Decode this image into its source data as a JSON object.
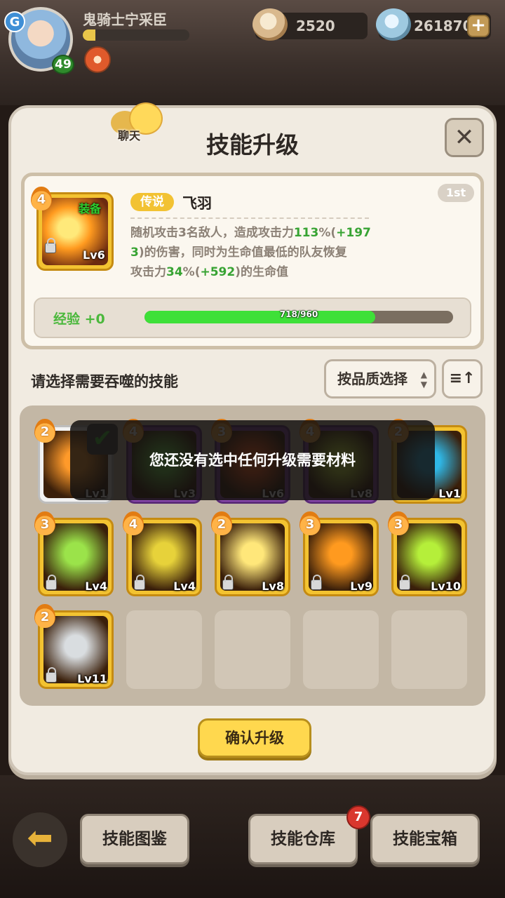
{
  "header": {
    "player_name": "鬼骑士宁采臣",
    "player_level": "49",
    "exp_fraction": 0.12,
    "avatar_badge": "G",
    "currency1": {
      "icon": "shell-icon",
      "value": "2520"
    },
    "currency2": {
      "icon": "gem-icon",
      "value": "261870",
      "add": "+"
    }
  },
  "panel": {
    "title": "技能升级",
    "chat_label": "聊天",
    "close": "✕"
  },
  "skill": {
    "rank": "1st",
    "star": "4",
    "equip_label": "装备",
    "level": "Lv6",
    "rarity": "传说",
    "name": "飞羽",
    "desc": {
      "p1": "随机攻击3名敌人，造成攻击力",
      "v1": "113",
      "p2": "%(",
      "v2": "+197",
      "br": "3",
      "p3": ")的伤害，同时为生命值最低的队友恢复",
      "p4": "攻击力",
      "v3": "34",
      "p5": "%(",
      "v4": "+592",
      "p6": ")的生命值"
    },
    "exp_label": "经验",
    "exp_gain": "+0",
    "exp_text": "718/960",
    "exp_current": 718,
    "exp_max": 960
  },
  "selection": {
    "label": "请选择需要吞噬的技能",
    "sort_dropdown": "按品质选择",
    "sort_icon": "≡↑"
  },
  "materials": [
    {
      "star": "2",
      "level": "Lv1",
      "frame": "white",
      "color": "#ff9a2a",
      "locked": false,
      "checked": true
    },
    {
      "star": "4",
      "level": "Lv3",
      "frame": "purple",
      "color": "#6ad24a",
      "locked": false
    },
    {
      "star": "3",
      "level": "Lv6",
      "frame": "purple",
      "color": "#ff5a1a",
      "locked": false
    },
    {
      "star": "4",
      "level": "Lv8",
      "frame": "purple",
      "color": "#c6e23a",
      "locked": false
    },
    {
      "star": "2",
      "level": "Lv1",
      "frame": "gold",
      "color": "#2fb7e6",
      "locked": false
    },
    {
      "star": "3",
      "level": "Lv4",
      "frame": "gold",
      "color": "#9be34a",
      "locked": true
    },
    {
      "star": "4",
      "level": "Lv4",
      "frame": "gold",
      "color": "#e7d23a",
      "locked": true
    },
    {
      "star": "2",
      "level": "Lv8",
      "frame": "gold",
      "color": "#ffe77a",
      "locked": true
    },
    {
      "star": "3",
      "level": "Lv9",
      "frame": "gold",
      "color": "#ff9a1f",
      "locked": true
    },
    {
      "star": "3",
      "level": "Lv10",
      "frame": "gold",
      "color": "#b5ef3a",
      "locked": true
    },
    {
      "star": "2",
      "level": "Lv11",
      "frame": "gold",
      "color": "#d9dde0",
      "locked": true
    }
  ],
  "toast": "您还没有选中任何升级需要材料",
  "confirm_button": "确认升级",
  "bottom_nav": {
    "back_icon": "back-arrow-icon",
    "codex": "技能图鉴",
    "warehouse": "技能仓库",
    "warehouse_badge": "7",
    "chest": "技能宝箱"
  }
}
